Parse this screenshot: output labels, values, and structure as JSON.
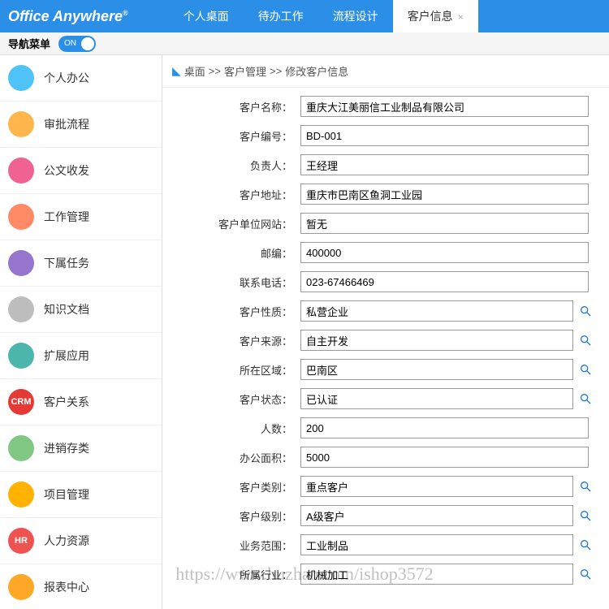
{
  "header": {
    "logo": "Office Anywhere",
    "tabs": [
      {
        "label": "个人桌面"
      },
      {
        "label": "待办工作"
      },
      {
        "label": "流程设计"
      },
      {
        "label": "客户信息",
        "active": true
      }
    ]
  },
  "subheader": {
    "nav_label": "导航菜单",
    "toggle": "ON"
  },
  "sidebar": {
    "items": [
      {
        "label": "个人办公",
        "cls": "i-blue"
      },
      {
        "label": "审批流程",
        "cls": "i-yellow"
      },
      {
        "label": "公文收发",
        "cls": "i-pink"
      },
      {
        "label": "工作管理",
        "cls": "i-orange"
      },
      {
        "label": "下属任务",
        "cls": "i-purple"
      },
      {
        "label": "知识文档",
        "cls": "i-grey"
      },
      {
        "label": "扩展应用",
        "cls": "i-teal"
      },
      {
        "label": "客户关系",
        "cls": "i-red",
        "badge": "CRM"
      },
      {
        "label": "进销存类",
        "cls": "i-green"
      },
      {
        "label": "项目管理",
        "cls": "i-amber"
      },
      {
        "label": "人力资源",
        "cls": "i-hr",
        "badge": "HR"
      },
      {
        "label": "报表中心",
        "cls": "i-report"
      }
    ]
  },
  "breadcrumb": {
    "p1": "桌面",
    "p2": "客户管理",
    "p3": "修改客户信息",
    "sep": ">>"
  },
  "form": {
    "rows": [
      {
        "label": "客户名称：",
        "value": "重庆大江美丽信工业制品有限公司",
        "lookup": false
      },
      {
        "label": "客户编号：",
        "value": "BD-001",
        "lookup": false
      },
      {
        "label": "负责人：",
        "value": "王经理",
        "lookup": false
      },
      {
        "label": "客户地址：",
        "value": "重庆市巴南区鱼洞工业园",
        "lookup": false
      },
      {
        "label": "客户单位网站：",
        "value": "暂无",
        "lookup": false
      },
      {
        "label": "邮编：",
        "value": "400000",
        "lookup": false
      },
      {
        "label": "联系电话：",
        "value": "023-67466469",
        "lookup": false
      },
      {
        "label": "客户性质：",
        "value": "私营企业",
        "lookup": true
      },
      {
        "label": "客户来源：",
        "value": "自主开发",
        "lookup": true
      },
      {
        "label": "所在区域：",
        "value": "巴南区",
        "lookup": true
      },
      {
        "label": "客户状态：",
        "value": "已认证",
        "lookup": true
      },
      {
        "label": "人数：",
        "value": "200",
        "lookup": false
      },
      {
        "label": "办公面积：",
        "value": "5000",
        "lookup": false
      },
      {
        "label": "客户类别：",
        "value": "重点客户",
        "lookup": true
      },
      {
        "label": "客户级别：",
        "value": "A级客户",
        "lookup": true
      },
      {
        "label": "业务范围：",
        "value": "工业制品",
        "lookup": true
      },
      {
        "label": "所属行业：",
        "value": "机械加工",
        "lookup": true
      }
    ]
  },
  "watermark": "https://www.huzhan.com/ishop3572"
}
